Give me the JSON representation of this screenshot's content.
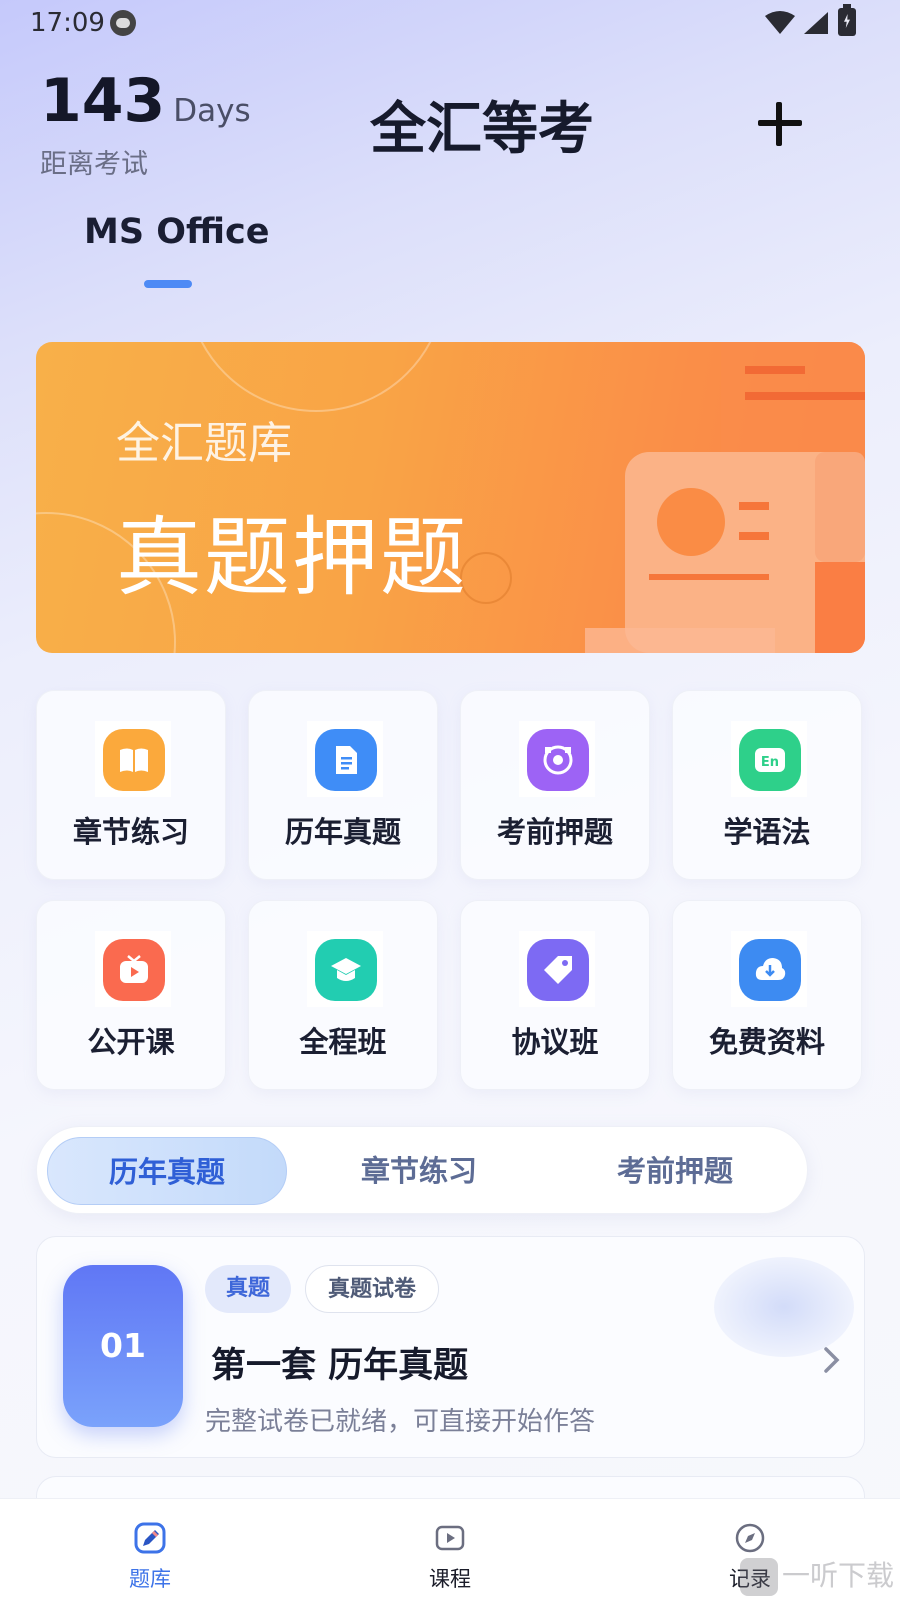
{
  "status_bar": {
    "time": "17:09"
  },
  "header": {
    "countdown_number": "143",
    "countdown_unit": "Days",
    "countdown_label": "距离考试",
    "app_title": "全汇等考"
  },
  "subject_tab": {
    "label": "MS Office"
  },
  "banner": {
    "subtitle": "全汇题库",
    "title": "真题押题"
  },
  "features": [
    {
      "label": "章节练习",
      "icon": "book-icon",
      "color": "#fba93c"
    },
    {
      "label": "历年真题",
      "icon": "document-icon",
      "color": "#3f8df7"
    },
    {
      "label": "考前押题",
      "icon": "target-icon",
      "color": "#9d63f5"
    },
    {
      "label": "学语法",
      "icon": "en-icon",
      "color": "#2ed08a"
    },
    {
      "label": "公开课",
      "icon": "tv-play-icon",
      "color": "#fa6a4f"
    },
    {
      "label": "全程班",
      "icon": "graduation-cap-icon",
      "color": "#22cdb1"
    },
    {
      "label": "协议班",
      "icon": "tag-icon",
      "color": "#7d6af3"
    },
    {
      "label": "免费资料",
      "icon": "cloud-download-icon",
      "color": "#3d8bf2"
    }
  ],
  "segments": [
    {
      "label": "历年真题",
      "active": true
    },
    {
      "label": "章节练习",
      "active": false
    },
    {
      "label": "考前押题",
      "active": false
    }
  ],
  "paper_card": {
    "number": "01",
    "tag_primary": "真题",
    "tag_secondary": "真题试卷",
    "title": "第一套 历年真题",
    "description": "完整试卷已就绪，可直接开始作答"
  },
  "bottom_nav": [
    {
      "label": "题库",
      "icon": "pencil-icon",
      "active": true
    },
    {
      "label": "课程",
      "icon": "play-icon",
      "active": false
    },
    {
      "label": "记录",
      "icon": "compass-icon",
      "active": false
    }
  ],
  "watermark": {
    "text": "一听下载"
  },
  "colors": {
    "accent": "#3d73e8",
    "banner_start": "#f8b049",
    "banner_end": "#fa8448"
  }
}
